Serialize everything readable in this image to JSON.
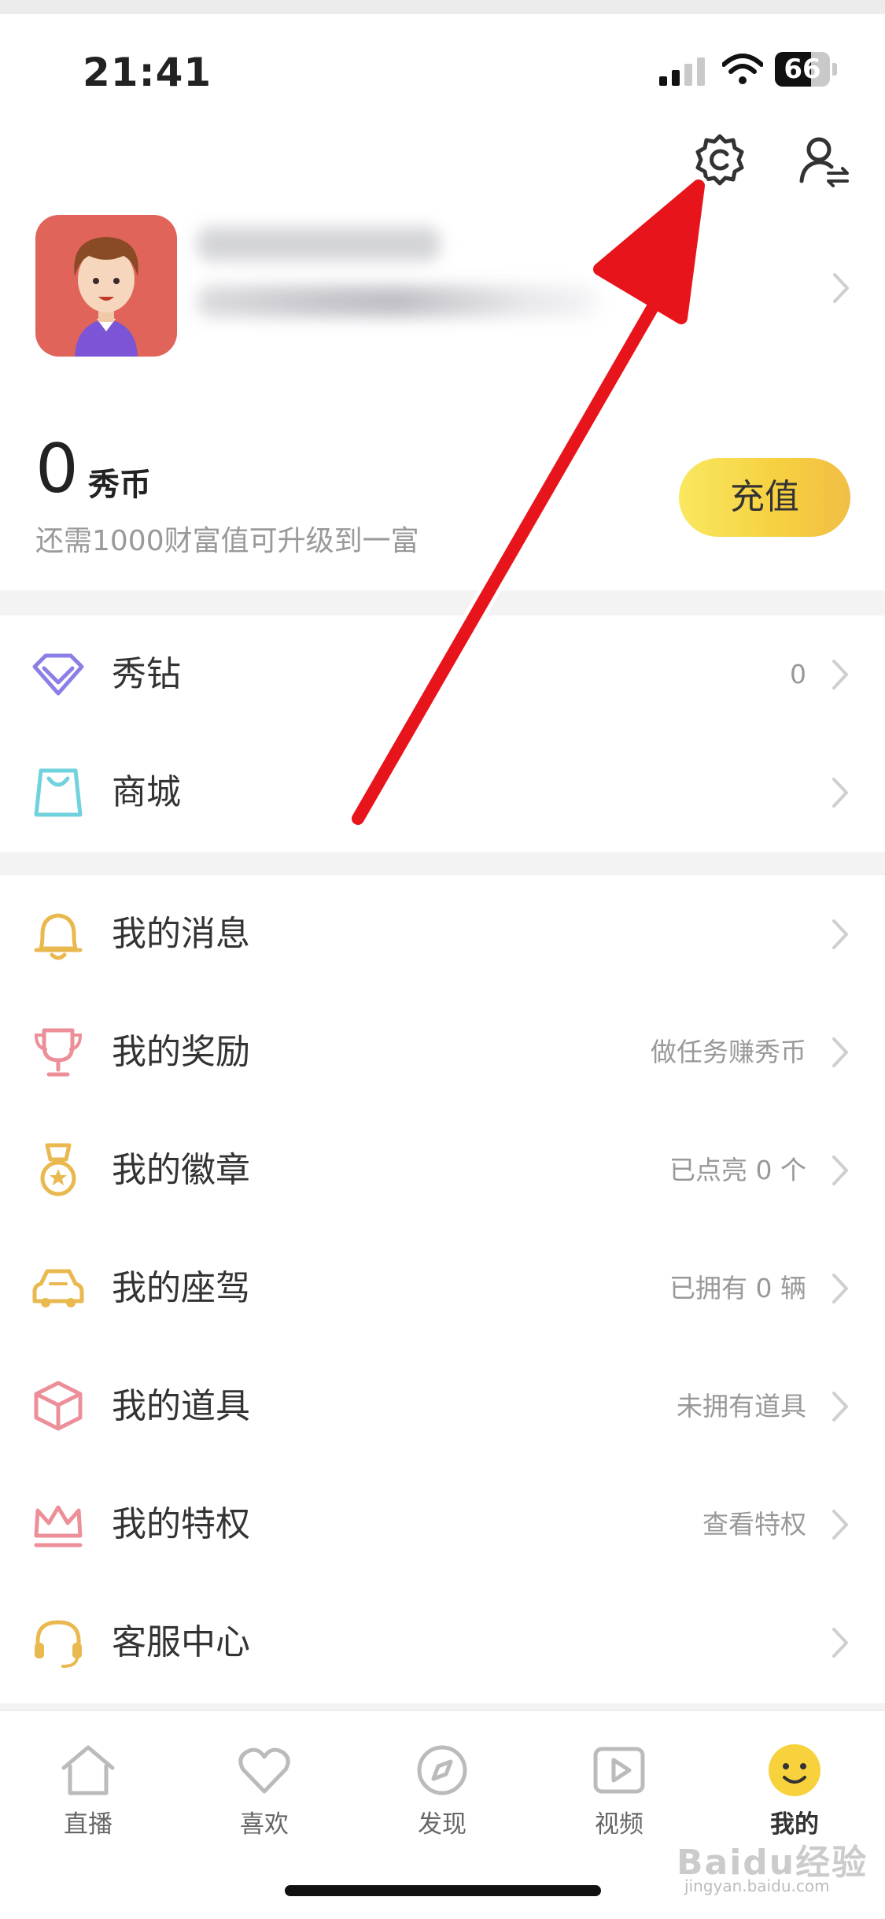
{
  "status_bar": {
    "time": "21:41",
    "battery": "66",
    "battery_level": 0.66
  },
  "header": {
    "icons": [
      "settings-icon",
      "switch-account-icon"
    ]
  },
  "wallet": {
    "coin_value": "0",
    "coin_unit": "秀币",
    "hint": "还需1000财富值可升级到一富",
    "recharge_label": "充值"
  },
  "group1": [
    {
      "label": "秀钻",
      "value": "0",
      "icon": "diamond-icon"
    },
    {
      "label": "商城",
      "value": "",
      "icon": "shopping-bag-icon"
    }
  ],
  "group2": [
    {
      "label": "我的消息",
      "value": "",
      "icon": "bell-icon"
    },
    {
      "label": "我的奖励",
      "value": "做任务赚秀币",
      "icon": "trophy-icon"
    },
    {
      "label": "我的徽章",
      "value": "已点亮 0 个",
      "icon": "medal-icon"
    },
    {
      "label": "我的座驾",
      "value": "已拥有 0 辆",
      "icon": "car-icon"
    },
    {
      "label": "我的道具",
      "value": "未拥有道具",
      "icon": "box-icon"
    },
    {
      "label": "我的特权",
      "value": "查看特权",
      "icon": "crown-icon"
    },
    {
      "label": "客服中心",
      "value": "",
      "icon": "headset-icon"
    }
  ],
  "tabs": [
    {
      "label": "直播",
      "icon": "home-icon"
    },
    {
      "label": "喜欢",
      "icon": "heart-icon"
    },
    {
      "label": "发现",
      "icon": "compass-icon"
    },
    {
      "label": "视频",
      "icon": "video-icon"
    },
    {
      "label": "我的",
      "icon": "smiley-icon",
      "active": true
    }
  ],
  "watermark": {
    "brand": "Baidu经验",
    "url": "jingyan.baidu.com"
  },
  "colors": {
    "accent_yellow": "#F6CF3F",
    "annotation_arrow": "#E8141B",
    "text_primary": "#333333",
    "text_secondary": "#999999"
  }
}
